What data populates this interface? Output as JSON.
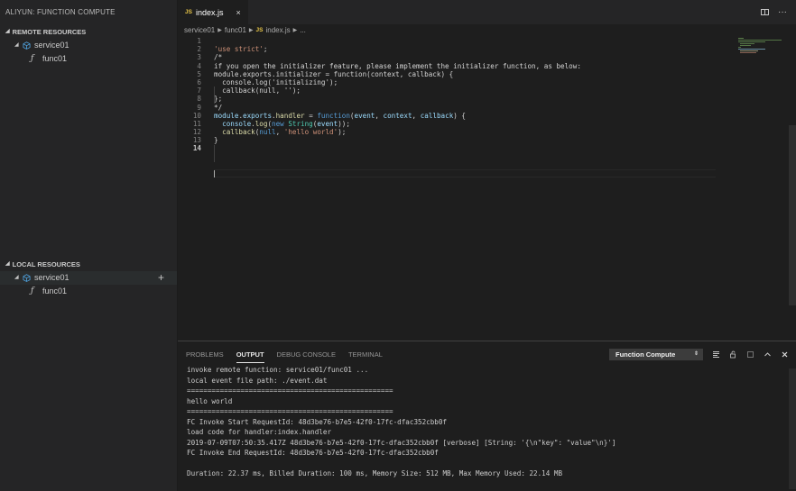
{
  "sidebar": {
    "title": "ALIYUN: FUNCTION COMPUTE",
    "remote": {
      "header": "REMOTE RESOURCES",
      "service": "service01",
      "function": "func01"
    },
    "local": {
      "header": "LOCAL RESOURCES",
      "service": "service01",
      "function": "func01"
    }
  },
  "editor_tab": {
    "badge": "JS",
    "filename": "index.js",
    "close": "×"
  },
  "breadcrumb": {
    "items": [
      "service01",
      "func01",
      "index.js",
      "..."
    ],
    "file_badge": "JS"
  },
  "code": {
    "lines": [
      {
        "num": "1"
      },
      {
        "num": "2"
      },
      {
        "num": "3"
      },
      {
        "num": "4"
      },
      {
        "num": "5"
      },
      {
        "num": "6"
      },
      {
        "num": "7"
      },
      {
        "num": "8"
      },
      {
        "num": "9"
      },
      {
        "num": "10"
      },
      {
        "num": "11"
      },
      {
        "num": "12"
      },
      {
        "num": "13"
      },
      {
        "num": "14"
      }
    ],
    "l2": "'use strict'",
    "l2_semi": ";",
    "l3": "/*",
    "l4": "if you open the initializer feature, please implement the initializer function, as below:",
    "l5": "module.exports.initializer = function(context, callback) {",
    "l6": "  console.log('initializing');",
    "l7": "  callback(null, '');",
    "l8": "};",
    "l9": "*/",
    "l10a": "module",
    "l10b": ".",
    "l10c": "exports",
    "l10d": ".",
    "l10e": "handler",
    "l10f": " = ",
    "l10g": "function",
    "l10h": "(",
    "l10i": "event",
    "l10j": ", ",
    "l10k": "context",
    "l10l": ", ",
    "l10m": "callback",
    "l10n": ") {",
    "l11a": "  console",
    "l11b": ".",
    "l11c": "log",
    "l11d": "(",
    "l11e": "new",
    "l11f": " ",
    "l11g": "String",
    "l11h": "(",
    "l11i": "event",
    "l11j": "));",
    "l12a": "  callback",
    "l12b": "(",
    "l12c": "null",
    "l12d": ", ",
    "l12e": "'hello world'",
    "l12f": ");",
    "l13": "}"
  },
  "panel": {
    "tabs": [
      "PROBLEMS",
      "OUTPUT",
      "DEBUG CONSOLE",
      "TERMINAL"
    ],
    "channel": "Function Compute",
    "output": [
      "invoke remote function: service01/func01 ...",
      "local event file path: ./event.dat",
      "==================================================",
      "hello world",
      "==================================================",
      "FC Invoke Start RequestId: 48d3be76-b7e5-42f0-17fc-dfac352cbb0f",
      "load code for handler:index.handler",
      "2019-07-09T07:50:35.417Z 48d3be76-b7e5-42f0-17fc-dfac352cbb0f [verbose] [String: '{\\n\"key\": \"value\"\\n}']",
      "FC Invoke End RequestId: 48d3be76-b7e5-42f0-17fc-dfac352cbb0f",
      "",
      "Duration: 22.37 ms, Billed Duration: 100 ms, Memory Size: 512 MB, Max Memory Used: 22.14 MB"
    ]
  },
  "icons": {
    "function_glyph": "ƒ",
    "add": "+",
    "more": "···",
    "accent_js": "#e8c547",
    "service_icon_color": "#4fa3e0"
  }
}
